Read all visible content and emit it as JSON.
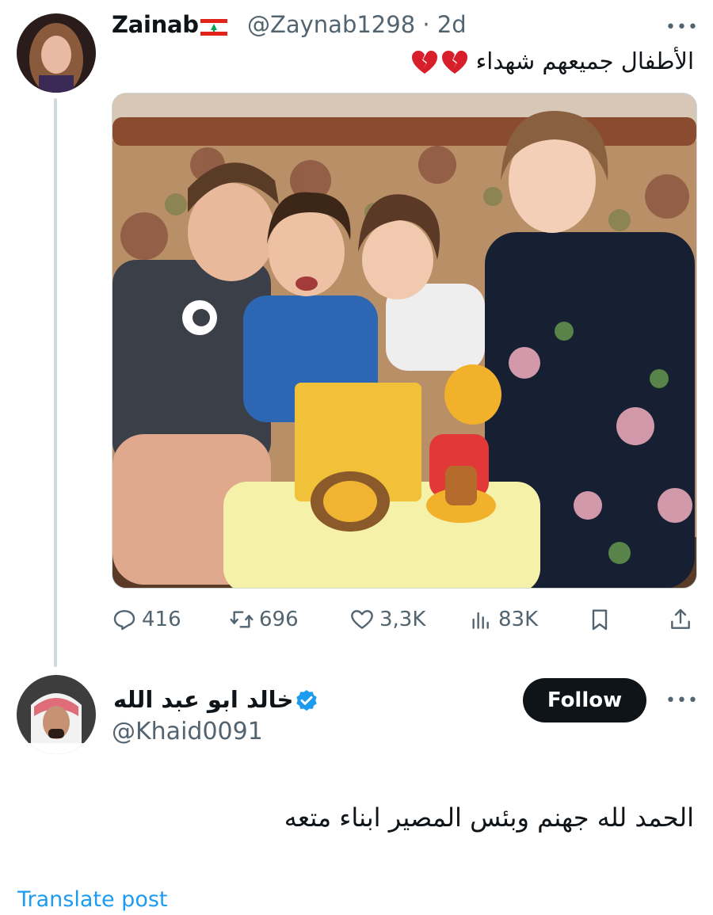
{
  "tweet1": {
    "name": "Zainab",
    "meta": "@Zaynab1298 · 2d",
    "text": "الأطفال جميعهم شهداء",
    "icons": {
      "flag": "lebanon-flag-icon",
      "emoji": "broken-heart-icon",
      "more": "more-options-icon"
    },
    "actions": {
      "reply": "416",
      "retweet": "696",
      "like": "3,3K",
      "views": "83K"
    }
  },
  "tweet2": {
    "name": "خالد ابو عبد الله",
    "handle": "@Khaid0091",
    "follow_label": "Follow",
    "text": "الحمد لله جهنم وبئس المصير ابناء متعه",
    "translate_label": "Translate post"
  },
  "colors": {
    "secondary_text": "#536471",
    "link": "#1d9bf0",
    "follow_bg": "#0f1419",
    "thread_line": "#cfd9de"
  }
}
